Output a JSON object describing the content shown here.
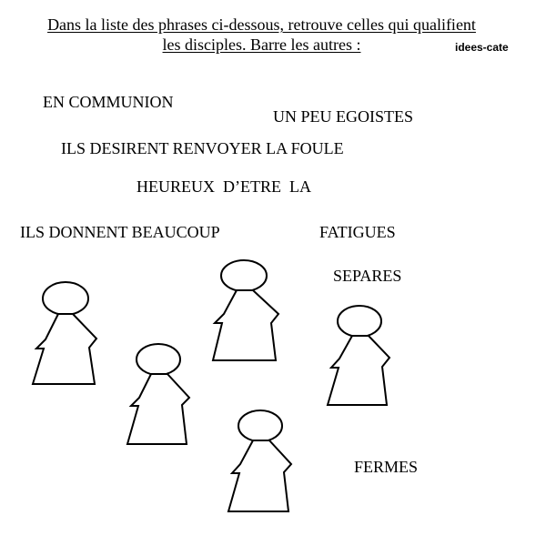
{
  "instruction": {
    "line1": "Dans la liste des phrases ci-dessous, retrouve celles qui qualifient",
    "line2": "les disciples. Barre les autres :"
  },
  "brand": "idees-cate",
  "phrases": [
    "EN COMMUNION",
    "UN PEU EGOISTES",
    "ILS DESIRENT RENVOYER LA FOULE",
    "HEUREUX  D’ETRE  LA",
    "ILS DONNENT BEAUCOUP",
    "FATIGUES",
    "SEPARES",
    "FERMES"
  ],
  "figures": [
    {
      "description": "disciple-figure"
    },
    {
      "description": "disciple-figure"
    },
    {
      "description": "disciple-figure"
    },
    {
      "description": "disciple-figure"
    },
    {
      "description": "disciple-figure"
    }
  ]
}
